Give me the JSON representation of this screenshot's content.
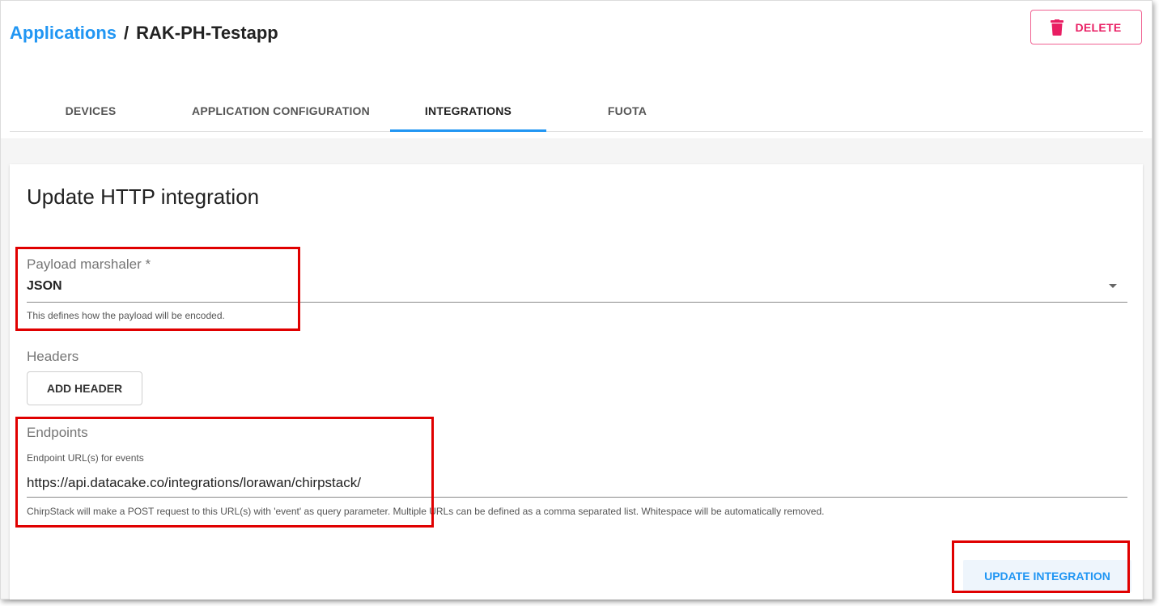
{
  "breadcrumb": {
    "link": "Applications",
    "separator": "/",
    "current": "RAK-PH-Testapp"
  },
  "actions": {
    "delete_label": "DELETE"
  },
  "tabs": [
    {
      "label": "DEVICES"
    },
    {
      "label": "APPLICATION CONFIGURATION"
    },
    {
      "label": "INTEGRATIONS"
    },
    {
      "label": "FUOTA"
    }
  ],
  "form": {
    "title": "Update HTTP integration",
    "payload_marshaler": {
      "label": "Payload marshaler *",
      "value": "JSON",
      "helper": "This defines how the payload will be encoded."
    },
    "headers": {
      "label": "Headers",
      "add_button": "ADD HEADER"
    },
    "endpoints": {
      "label": "Endpoints",
      "field_label": "Endpoint URL(s) for events",
      "value": "https://api.datacake.co/integrations/lorawan/chirpstack/",
      "helper": "ChirpStack will make a POST request to this URL(s) with 'event' as query parameter. Multiple URLs can be defined as a comma separated list. Whitespace will be automatically removed."
    },
    "submit_label": "UPDATE INTEGRATION"
  },
  "colors": {
    "accent": "#2196f3",
    "danger": "#e91e63",
    "highlight": "#e00000"
  }
}
